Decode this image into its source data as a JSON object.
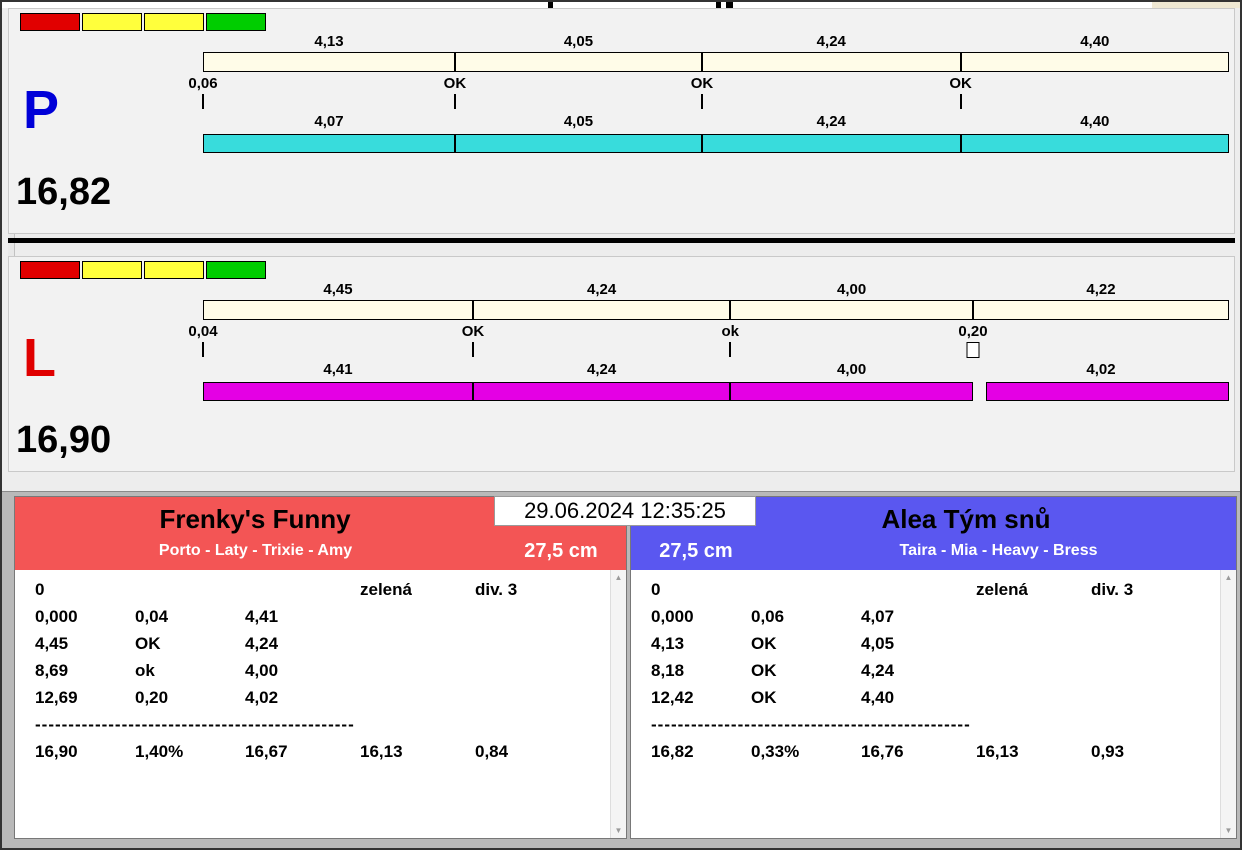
{
  "datetime": "29.06.2024 12:35:25",
  "icons": {
    "scroll_up": "▲",
    "scroll_down": "▼"
  },
  "strip_colors": [
    "#e10000",
    "#ffff3c",
    "#ffff3c",
    "#00cd00"
  ],
  "lanes": [
    {
      "letter": "P",
      "letter_color": "#0000d8",
      "total": "16,82",
      "upper_bar_color": "#fffce8",
      "lower_bar_color": "#38dcdc",
      "upper_labels": [
        "4,13",
        "4,05",
        "4,24",
        "4,40"
      ],
      "upper_values": [
        4.13,
        4.05,
        4.24,
        4.4
      ],
      "markers": [
        {
          "label": "0,06",
          "tick": "line"
        },
        {
          "label": "OK",
          "tick": "line"
        },
        {
          "label": "OK",
          "tick": "line"
        },
        {
          "label": "OK",
          "tick": "line"
        }
      ],
      "lower_labels": [
        "4,07",
        "4,05",
        "4,24",
        "4,40"
      ],
      "gap_before_last_segment": false
    },
    {
      "letter": "L",
      "letter_color": "#e00000",
      "total": "16,90",
      "upper_bar_color": "#fffce8",
      "lower_bar_color": "#e400e4",
      "upper_labels": [
        "4,45",
        "4,24",
        "4,00",
        "4,22"
      ],
      "upper_values": [
        4.45,
        4.24,
        4.0,
        4.22
      ],
      "markers": [
        {
          "label": "0,04",
          "tick": "line"
        },
        {
          "label": "OK",
          "tick": "line"
        },
        {
          "label": "ok",
          "tick": "line"
        },
        {
          "label": "0,20",
          "tick": "box"
        }
      ],
      "lower_labels": [
        "4,41",
        "4,24",
        "4,00",
        "4,02"
      ],
      "gap_before_last_segment": true
    }
  ],
  "teams": [
    {
      "name": "Frenky's Funny",
      "members": "Porto - Laty - Trixie - Amy",
      "height": "27,5 cm",
      "header_color": "#f35555",
      "rows": [
        [
          "0",
          "",
          "",
          "zelená",
          "div. 3"
        ],
        [
          "0,000",
          "0,04",
          "4,41",
          "",
          ""
        ],
        [
          "4,45",
          "OK",
          "4,24",
          "",
          ""
        ],
        [
          "8,69",
          "ok",
          "4,00",
          "",
          ""
        ],
        [
          "12,69",
          "0,20",
          "4,02",
          "",
          ""
        ]
      ],
      "separator": "------------------------------------------------",
      "total_row": [
        "16,90",
        "1,40%",
        "16,67",
        "16,13",
        "0,84"
      ]
    },
    {
      "name": "Alea Tým snů",
      "members": "Taira - Mia - Heavy - Bress",
      "height": "27,5 cm",
      "header_color": "#5a57f0",
      "rows": [
        [
          "0",
          "",
          "",
          "zelená",
          "div. 3"
        ],
        [
          "0,000",
          "0,06",
          "4,07",
          "",
          ""
        ],
        [
          "4,13",
          "OK",
          "4,05",
          "",
          ""
        ],
        [
          "8,18",
          "OK",
          "4,24",
          "",
          ""
        ],
        [
          "12,42",
          "OK",
          "4,40",
          "",
          ""
        ]
      ],
      "separator": "------------------------------------------------",
      "total_row": [
        "16,82",
        "0,33%",
        "16,76",
        "16,13",
        "0,93"
      ]
    }
  ]
}
